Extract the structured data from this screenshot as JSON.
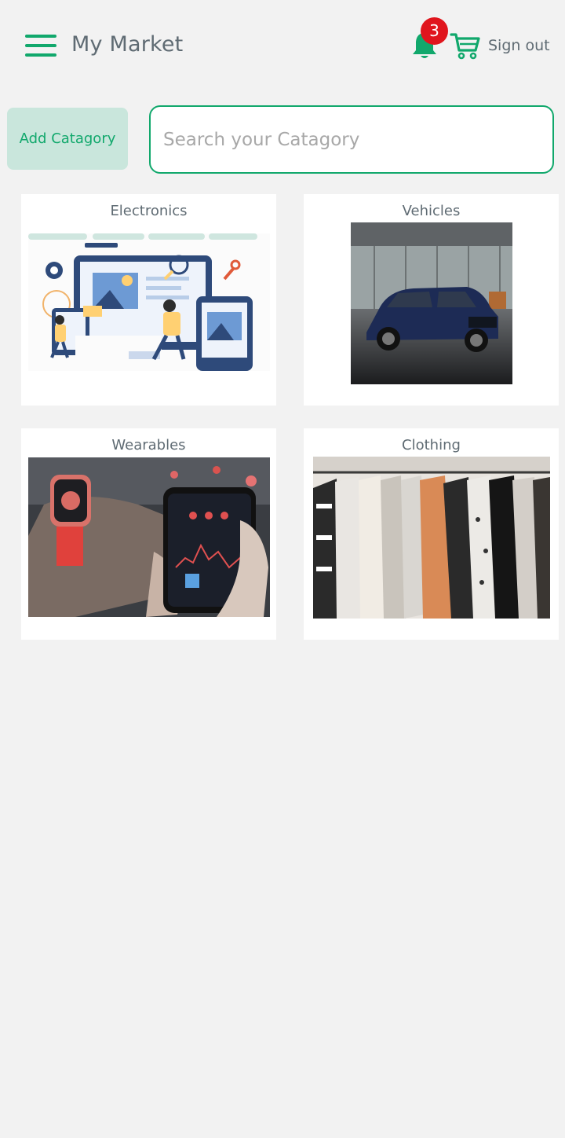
{
  "header": {
    "title": "My Market",
    "notification_count": "3",
    "signout_label": "Sign out"
  },
  "toolbar": {
    "add_category_label": "Add Catagory",
    "search_placeholder": "Search your Catagory"
  },
  "categories": [
    {
      "label": "Electronics",
      "image": "electronics-illustration"
    },
    {
      "label": "Vehicles",
      "image": "suv-photo"
    },
    {
      "label": "Wearables",
      "image": "smartwatch-phone-photo"
    },
    {
      "label": "Clothing",
      "image": "clothing-rack-photo"
    }
  ],
  "colors": {
    "accent": "#11a86c",
    "badge": "#e0151d",
    "button_bg": "#c9e6dc",
    "text": "#5f6b73",
    "background": "#f2f2f2"
  }
}
